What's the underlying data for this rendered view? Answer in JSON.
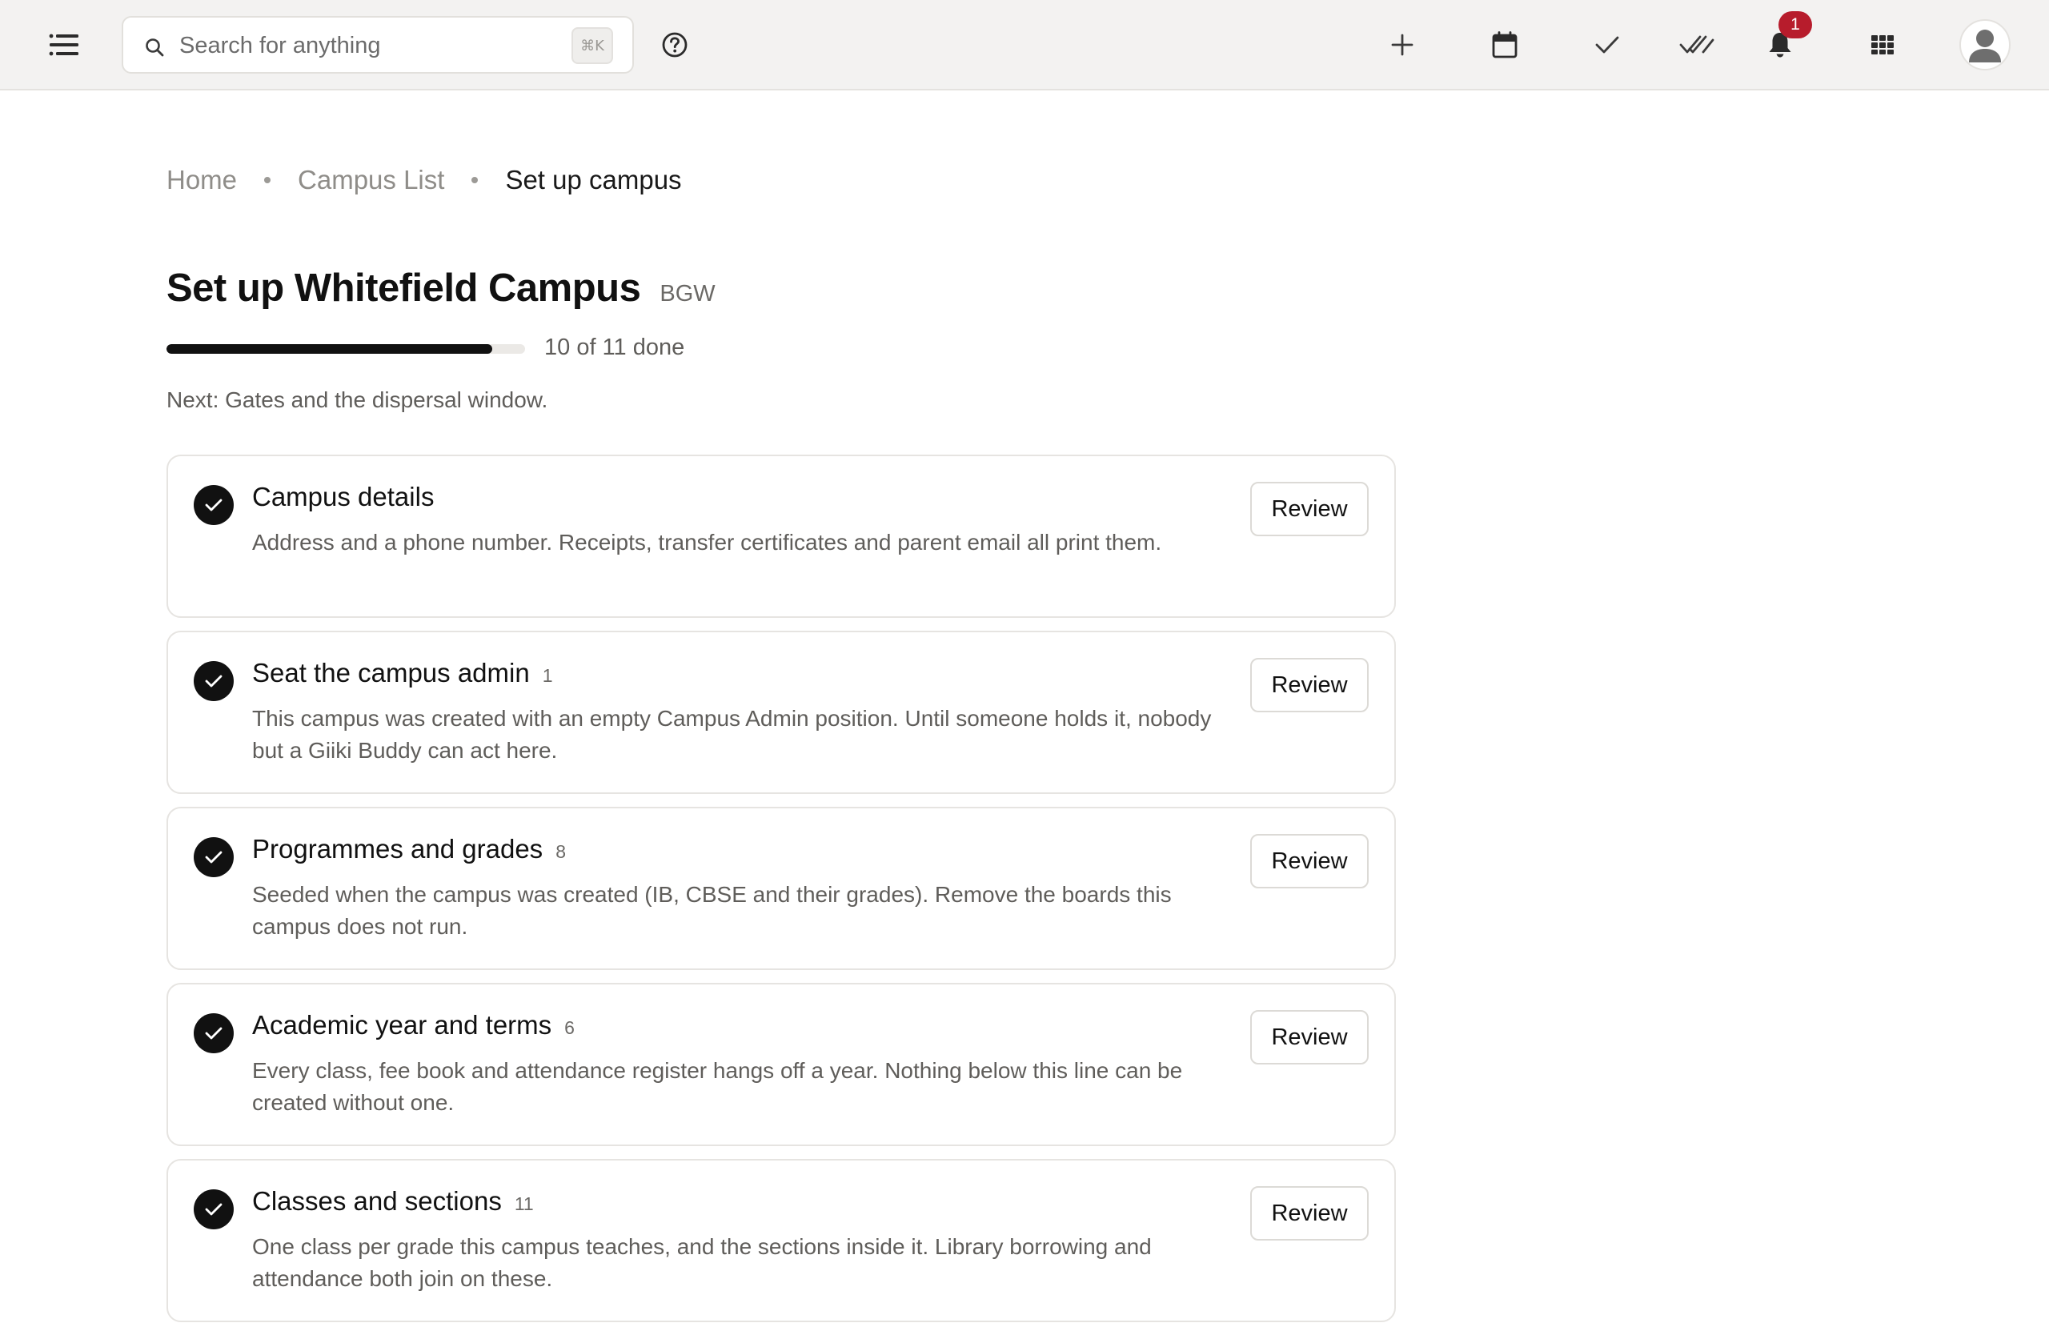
{
  "topbar": {
    "search": {
      "placeholder": "Search for anything",
      "shortcut": "⌘K"
    },
    "notifications_count": "1",
    "icons": {
      "menu": "menu-icon",
      "search": "search-icon",
      "help": "help-circle-icon",
      "add": "plus-icon",
      "calendar": "calendar-icon",
      "check": "check-icon",
      "double_check": "double-check-icon",
      "bell": "bell-icon",
      "apps": "grid-icon",
      "avatar": "user-icon"
    }
  },
  "breadcrumb": {
    "items": [
      "Home",
      "Campus List"
    ],
    "current": "Set up campus"
  },
  "header": {
    "title": "Set up Whitefield Campus",
    "code": "BGW",
    "progress_text": "10 of 11 done",
    "progress_fraction": 0.909,
    "next": "Next: Gates and the dispersal window."
  },
  "steps": [
    {
      "title": "Campus details",
      "count": "",
      "description": "Address and a phone number. Receipts, transfer certificates and parent email all print them.",
      "action": "Review",
      "done": true
    },
    {
      "title": "Seat the campus admin",
      "count": "1",
      "description": "This campus was created with an empty Campus Admin position. Until someone holds it, nobody but a Giiki Buddy can act here.",
      "action": "Review",
      "done": true
    },
    {
      "title": "Programmes and grades",
      "count": "8",
      "description": "Seeded when the campus was created (IB, CBSE and their grades). Remove the boards this campus does not run.",
      "action": "Review",
      "done": true
    },
    {
      "title": "Academic year and terms",
      "count": "6",
      "description": "Every class, fee book and attendance register hangs off a year. Nothing below this line can be created without one.",
      "action": "Review",
      "done": true
    },
    {
      "title": "Classes and sections",
      "count": "11",
      "description": "One class per grade this campus teaches, and the sections inside it. Library borrowing and attendance both join on these.",
      "action": "Review",
      "done": true
    }
  ],
  "colors": {
    "topbar_bg": "#f3f2f1",
    "accent": "#111111",
    "badge": "#b71c2c",
    "muted_text": "#5f5d5a"
  }
}
